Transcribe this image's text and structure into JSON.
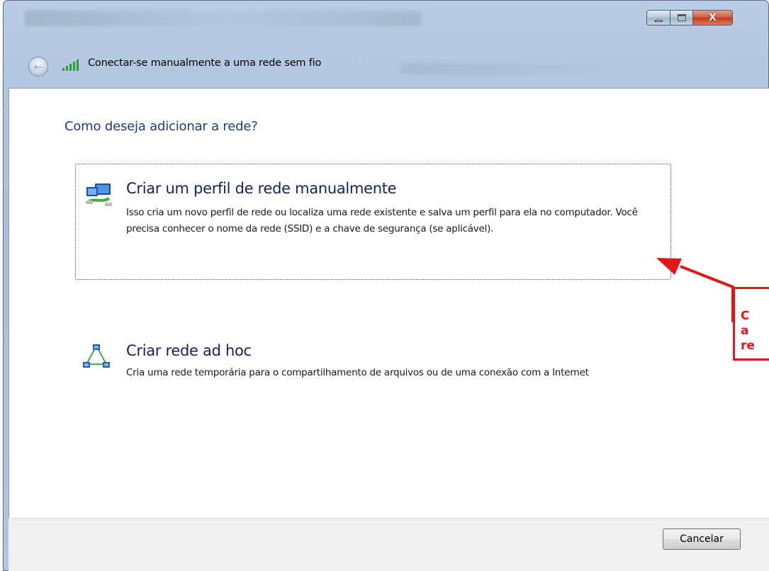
{
  "window": {
    "title": "Conectar-se manualmente a uma rede sem fio",
    "caption_buttons": {
      "minimize_icon": "minimize-icon",
      "maximize_icon": "maximize-icon",
      "close_glyph": "X"
    }
  },
  "navigation": {
    "back_icon": "back-arrow-icon",
    "back_glyph": "←",
    "signal_icon": "wifi-signal-icon"
  },
  "main": {
    "question": "Como deseja adicionar a rede?",
    "options": [
      {
        "icon": "network-profile-icon",
        "title": "Criar um perfil de rede manualmente",
        "description": "Isso cria um novo perfil de rede ou localiza uma rede existente e salva um perfil para ela no computador. Você precisa conhecer o nome da rede (SSID) e a chave de segurança (se aplicável).",
        "focused": true
      },
      {
        "icon": "adhoc-network-icon",
        "title": "Criar rede ad hoc",
        "description": "Cria uma rede temporária para o compartilhamento de arquivos ou de uma conexão com a Internet",
        "focused": false
      }
    ]
  },
  "footer": {
    "cancel_label": "Cancelar"
  },
  "annotation": {
    "text": "C\na\nre",
    "color": "#e21818"
  },
  "colors": {
    "heading": "#1f3d7a",
    "option_title": "#15215e",
    "annotation": "#e21818"
  }
}
